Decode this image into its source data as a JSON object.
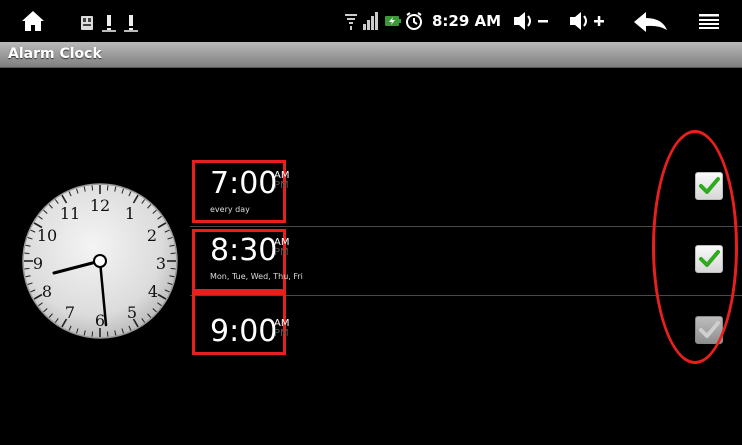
{
  "status_bar": {
    "time": "8:29 AM",
    "icons": [
      "home-icon",
      "notification-icon",
      "warning-icon",
      "warning-icon",
      "wifi-icon",
      "signal-icon",
      "battery-icon",
      "alarm-icon",
      "volume-down-icon",
      "volume-up-icon",
      "back-icon",
      "menu-icon"
    ]
  },
  "app": {
    "title": "Alarm Clock"
  },
  "clock": {
    "numbers": [
      "12",
      "1",
      "2",
      "3",
      "4",
      "5",
      "6",
      "7",
      "8",
      "9",
      "10",
      "11"
    ],
    "time_shown": "8:29"
  },
  "alarms": [
    {
      "time": "7:00",
      "am": "AM",
      "pm": "PM",
      "days": "every day",
      "enabled": true
    },
    {
      "time": "8:30",
      "am": "AM",
      "pm": "PM",
      "days": "Mon, Tue, Wed, Thu, Fri",
      "enabled": true
    },
    {
      "time": "9:00",
      "am": "AM",
      "pm": "PM",
      "days": "",
      "enabled": false
    }
  ],
  "colors": {
    "highlight": "#e8201d",
    "check_green": "#2faa1f",
    "title_bar": "#9a9a9a",
    "background": "#000000"
  }
}
